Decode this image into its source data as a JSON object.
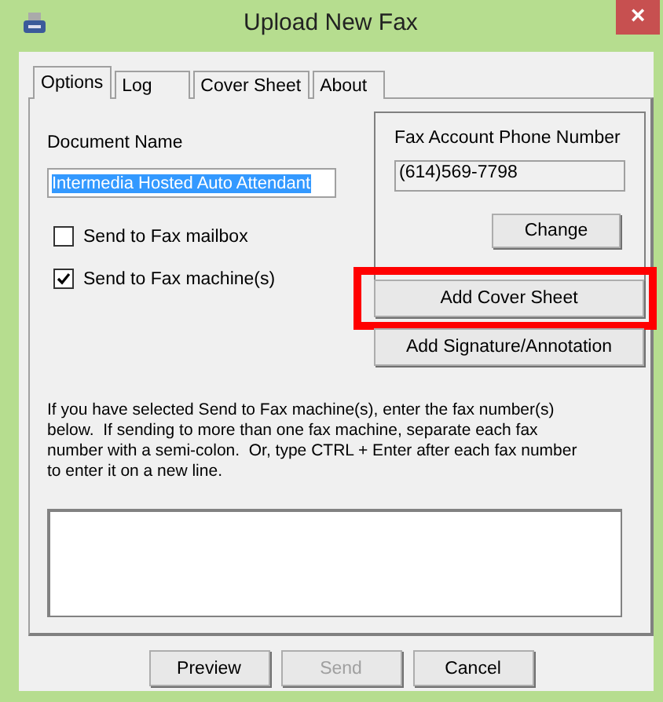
{
  "window": {
    "title": "Upload New Fax",
    "close": "×"
  },
  "tabs": [
    {
      "label": "Options",
      "selected": true
    },
    {
      "label": "Log",
      "selected": false
    },
    {
      "label": "Cover Sheet",
      "selected": false
    },
    {
      "label": "About",
      "selected": false
    }
  ],
  "document_name": {
    "label": "Document Name",
    "value": "Intermedia Hosted Auto Attendant",
    "selected_text": true
  },
  "checkboxes": [
    {
      "label": "Send to Fax mailbox",
      "checked": false
    },
    {
      "label": "Send to Fax machine(s)",
      "checked": true
    }
  ],
  "account": {
    "label": "Fax Account Phone Number",
    "value": "(614)569-7798",
    "button": "Change"
  },
  "side_buttons": [
    {
      "label": "Add Cover Sheet",
      "highlighted": true
    },
    {
      "label": "Add Signature/Annotation",
      "highlighted": false
    }
  ],
  "instructions": "If you have selected Send to Fax machine(s), enter the fax number(s) below.  If sending to more than one fax machine, separate each fax number with a semi-colon.  Or, type CTRL + Enter after each fax number to enter it on a new line.",
  "buttons": [
    {
      "label": "Preview",
      "disabled": false
    },
    {
      "label": "Send",
      "disabled": true
    },
    {
      "label": "Cancel",
      "disabled": false
    }
  ]
}
